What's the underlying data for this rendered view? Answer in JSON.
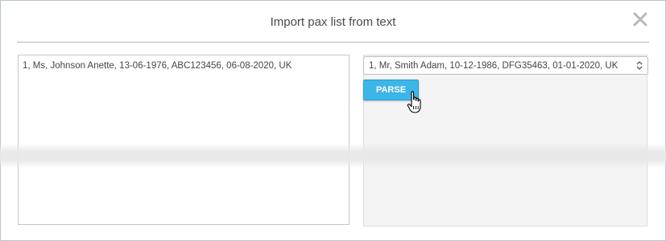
{
  "dialog": {
    "title": "Import pax list from text",
    "close_icon": "close-icon"
  },
  "input": {
    "value": "1, Ms, Johnson Anette, 13-06-1976, ABC123456, 06-08-2020, UK"
  },
  "parsed_select": {
    "selected": "1, Mr, Smith Adam, 10-12-1986, DFG35463, 01-01-2020, UK",
    "arrow_icon": "up-down-arrows-icon"
  },
  "parse_button": {
    "label": "PARSE",
    "color": "#3cb5e8"
  },
  "cursor_icon": "hand-pointer-icon"
}
